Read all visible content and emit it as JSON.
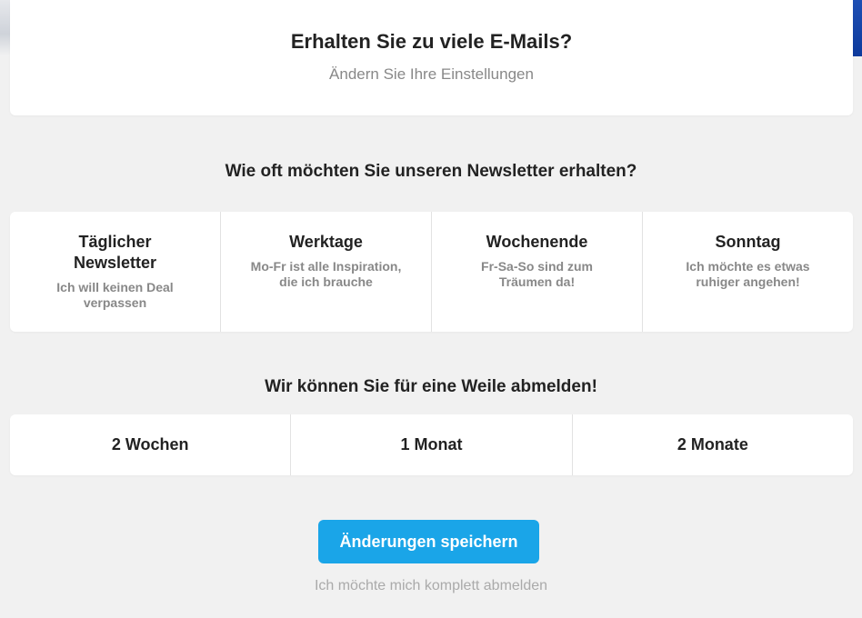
{
  "header": {
    "title": "Erhalten Sie zu viele E-Mails?",
    "subtitle": "Ändern Sie Ihre Einstellungen"
  },
  "frequency": {
    "heading": "Wie oft möchten Sie unseren Newsletter erhalten?",
    "options": [
      {
        "title": "Täglicher Newsletter",
        "description": "Ich will keinen Deal verpassen"
      },
      {
        "title": "Werktage",
        "description": "Mo-Fr ist alle Inspiration, die ich brauche"
      },
      {
        "title": "Wochenende",
        "description": "Fr-Sa-So sind zum Träumen da!"
      },
      {
        "title": "Sonntag",
        "description": "Ich möchte es etwas ruhiger angehen!"
      }
    ]
  },
  "pause": {
    "heading": "Wir können Sie für eine Weile abmelden!",
    "options": [
      "2 Wochen",
      "1 Monat",
      "2 Monate"
    ]
  },
  "actions": {
    "save_label": "Änderungen speichern",
    "unsubscribe_label": "Ich möchte mich komplett abmelden"
  },
  "colors": {
    "accent": "#1aa5e8",
    "background": "#f1f1f1",
    "card": "#ffffff",
    "muted_text": "#888888"
  }
}
